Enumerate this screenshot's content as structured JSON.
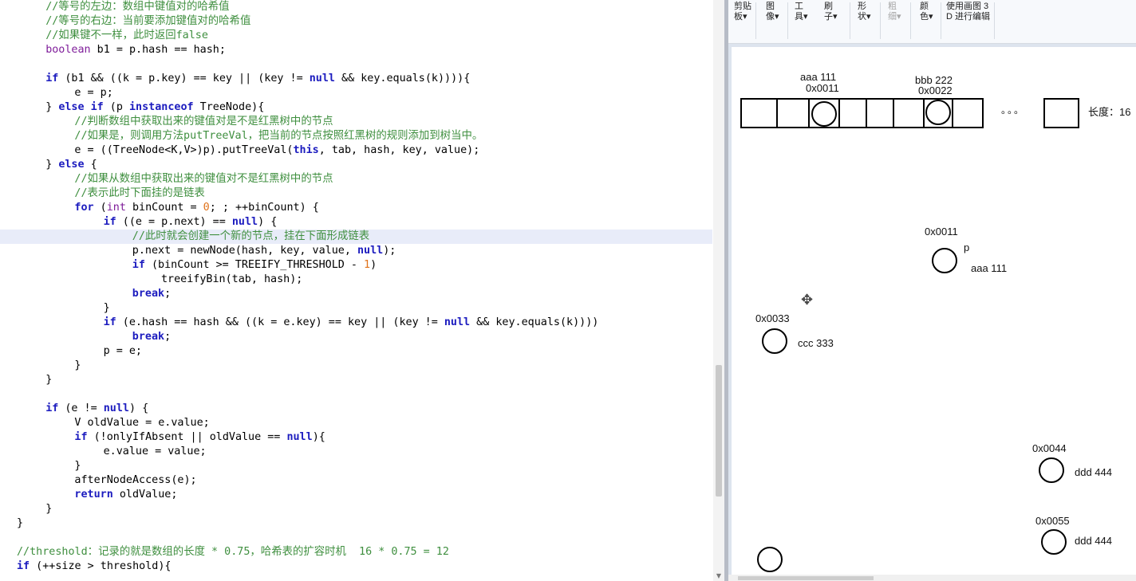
{
  "editor": {
    "lines": [
      {
        "indent": 4,
        "tokens": [
          {
            "t": "cm",
            "v": "//等号的左边：数组中键值对的哈希值"
          }
        ]
      },
      {
        "indent": 4,
        "tokens": [
          {
            "t": "cm",
            "v": "//等号的右边：当前要添加键值对的哈希值"
          }
        ]
      },
      {
        "indent": 4,
        "tokens": [
          {
            "t": "cm",
            "v": "//如果键不一样，此时返回false"
          }
        ]
      },
      {
        "indent": 4,
        "tokens": [
          {
            "t": "ty",
            "v": "boolean"
          },
          {
            "t": "tx",
            "v": " b1 = p.hash == hash;"
          }
        ]
      },
      {
        "indent": 0,
        "tokens": []
      },
      {
        "indent": 4,
        "tokens": [
          {
            "t": "kw",
            "v": "if"
          },
          {
            "t": "tx",
            "v": " (b1 && ((k = p.key) == key || (key != "
          },
          {
            "t": "kw",
            "v": "null"
          },
          {
            "t": "tx",
            "v": " && key.equals(k)))){"
          }
        ]
      },
      {
        "indent": 8,
        "tokens": [
          {
            "t": "tx",
            "v": "e = p;"
          }
        ]
      },
      {
        "indent": 4,
        "tokens": [
          {
            "t": "tx",
            "v": "} "
          },
          {
            "t": "kw",
            "v": "else if"
          },
          {
            "t": "tx",
            "v": " (p "
          },
          {
            "t": "kw",
            "v": "instanceof"
          },
          {
            "t": "tx",
            "v": " TreeNode){"
          }
        ]
      },
      {
        "indent": 8,
        "tokens": [
          {
            "t": "cm",
            "v": "//判断数组中获取出来的键值对是不是红黑树中的节点"
          }
        ]
      },
      {
        "indent": 8,
        "tokens": [
          {
            "t": "cm",
            "v": "//如果是，则调用方法putTreeVal，把当前的节点按照红黑树的规则添加到树当中。"
          }
        ]
      },
      {
        "indent": 8,
        "tokens": [
          {
            "t": "tx",
            "v": "e = ((TreeNode<K,V>)p).putTreeVal("
          },
          {
            "t": "kw",
            "v": "this"
          },
          {
            "t": "tx",
            "v": ", tab, hash, key, value);"
          }
        ]
      },
      {
        "indent": 4,
        "tokens": [
          {
            "t": "tx",
            "v": "} "
          },
          {
            "t": "kw",
            "v": "else"
          },
          {
            "t": "tx",
            "v": " {"
          }
        ]
      },
      {
        "indent": 8,
        "tokens": [
          {
            "t": "cm",
            "v": "//如果从数组中获取出来的键值对不是红黑树中的节点"
          }
        ]
      },
      {
        "indent": 8,
        "tokens": [
          {
            "t": "cm",
            "v": "//表示此时下面挂的是链表"
          }
        ]
      },
      {
        "indent": 8,
        "tokens": [
          {
            "t": "kw",
            "v": "for"
          },
          {
            "t": "tx",
            "v": " ("
          },
          {
            "t": "ty",
            "v": "int"
          },
          {
            "t": "tx",
            "v": " binCount = "
          },
          {
            "t": "num",
            "v": "0"
          },
          {
            "t": "tx",
            "v": "; ; ++binCount) {"
          }
        ]
      },
      {
        "indent": 12,
        "tokens": [
          {
            "t": "kw",
            "v": "if"
          },
          {
            "t": "tx",
            "v": " ((e = p.next) == "
          },
          {
            "t": "kw",
            "v": "null"
          },
          {
            "t": "tx",
            "v": ") {"
          }
        ]
      },
      {
        "indent": 16,
        "hl": true,
        "tokens": [
          {
            "t": "cm",
            "v": "//此时就会创建一个新的节点，挂在下面形成链表"
          }
        ]
      },
      {
        "indent": 16,
        "tokens": [
          {
            "t": "tx",
            "v": "p.next = newNode(hash, key, value, "
          },
          {
            "t": "kw",
            "v": "null"
          },
          {
            "t": "tx",
            "v": ");"
          }
        ]
      },
      {
        "indent": 16,
        "tokens": [
          {
            "t": "kw",
            "v": "if"
          },
          {
            "t": "tx",
            "v": " (binCount >= TREEIFY_THRESHOLD - "
          },
          {
            "t": "num",
            "v": "1"
          },
          {
            "t": "tx",
            "v": ")"
          }
        ]
      },
      {
        "indent": 20,
        "tokens": [
          {
            "t": "tx",
            "v": "treeifyBin(tab, hash);"
          }
        ]
      },
      {
        "indent": 16,
        "tokens": [
          {
            "t": "kw",
            "v": "break"
          },
          {
            "t": "tx",
            "v": ";"
          }
        ]
      },
      {
        "indent": 12,
        "tokens": [
          {
            "t": "tx",
            "v": "}"
          }
        ]
      },
      {
        "indent": 12,
        "tokens": [
          {
            "t": "kw",
            "v": "if"
          },
          {
            "t": "tx",
            "v": " (e.hash == hash && ((k = e.key) == key || (key != "
          },
          {
            "t": "kw",
            "v": "null"
          },
          {
            "t": "tx",
            "v": " && key.equals(k))))"
          }
        ]
      },
      {
        "indent": 16,
        "tokens": [
          {
            "t": "kw",
            "v": "break"
          },
          {
            "t": "tx",
            "v": ";"
          }
        ]
      },
      {
        "indent": 12,
        "tokens": [
          {
            "t": "tx",
            "v": "p = e;"
          }
        ]
      },
      {
        "indent": 8,
        "tokens": [
          {
            "t": "tx",
            "v": "}"
          }
        ]
      },
      {
        "indent": 4,
        "tokens": [
          {
            "t": "tx",
            "v": "}"
          }
        ]
      },
      {
        "indent": 0,
        "tokens": []
      },
      {
        "indent": 4,
        "tokens": [
          {
            "t": "kw",
            "v": "if"
          },
          {
            "t": "tx",
            "v": " (e != "
          },
          {
            "t": "kw",
            "v": "null"
          },
          {
            "t": "tx",
            "v": ") {"
          }
        ]
      },
      {
        "indent": 8,
        "tokens": [
          {
            "t": "tx",
            "v": "V oldValue = e.value;"
          }
        ]
      },
      {
        "indent": 8,
        "tokens": [
          {
            "t": "kw",
            "v": "if"
          },
          {
            "t": "tx",
            "v": " (!onlyIfAbsent || oldValue == "
          },
          {
            "t": "kw",
            "v": "null"
          },
          {
            "t": "tx",
            "v": "){"
          }
        ]
      },
      {
        "indent": 12,
        "tokens": [
          {
            "t": "tx",
            "v": "e.value = value;"
          }
        ]
      },
      {
        "indent": 8,
        "tokens": [
          {
            "t": "tx",
            "v": "}"
          }
        ]
      },
      {
        "indent": 8,
        "tokens": [
          {
            "t": "tx",
            "v": "afterNodeAccess(e);"
          }
        ]
      },
      {
        "indent": 8,
        "tokens": [
          {
            "t": "kw",
            "v": "return"
          },
          {
            "t": "tx",
            "v": " oldValue;"
          }
        ]
      },
      {
        "indent": 4,
        "tokens": [
          {
            "t": "tx",
            "v": "}"
          }
        ]
      },
      {
        "indent": 0,
        "tokens": [
          {
            "t": "tx",
            "v": "}"
          }
        ]
      },
      {
        "indent": 0,
        "tokens": []
      },
      {
        "indent": 0,
        "tokens": [
          {
            "t": "cm",
            "v": "//threshold：记录的就是数组的长度 * 0.75，哈希表的扩容时机  16 * 0.75 = 12"
          }
        ]
      },
      {
        "indent": 0,
        "tokens": [
          {
            "t": "kw",
            "v": "if"
          },
          {
            "t": "tx",
            "v": " (++size > threshold){"
          }
        ]
      }
    ]
  },
  "ribbon": {
    "clipboard": {
      "line1": "剪贴",
      "line2": "板▾"
    },
    "image": {
      "line1": "图",
      "line2": "像▾"
    },
    "tools": {
      "line1": "工",
      "line2": "具▾"
    },
    "brushes": {
      "line1": "刷",
      "line2": "子▾"
    },
    "shapes": {
      "line1": "形",
      "line2": "状▾"
    },
    "size": {
      "line1": "粗",
      "line2": "细▾"
    },
    "colors": {
      "line1": "颜",
      "line2": "色▾"
    },
    "paint3d": {
      "line1": "使用画图 3",
      "line2": "D 进行编辑"
    }
  },
  "drawing": {
    "array_labels": {
      "aaa": "aaa  111",
      "addr_0011_top": "0x0011",
      "bbb": "bbb 222",
      "addr_0022_top": "0x0022",
      "ellipsis": "。。。",
      "length": "长度：16"
    },
    "nodes": {
      "n1_addr": "0x0011",
      "n1_var": "p",
      "n1_value": "aaa  111",
      "n2_addr": "0x0033",
      "n2_value": "ccc 333",
      "n3_addr": "0x0044",
      "n3_value": "ddd 444",
      "n4_addr": "0x0055",
      "n4_value": "ddd 444"
    }
  },
  "colors": {
    "keyword": "#1c1cbf",
    "type": "#7f1d9a",
    "comment": "#3f8f3f",
    "number": "#e0731b",
    "highlight_line": "#e8ecf9"
  },
  "icons": {
    "cursor": "move-cursor-icon",
    "scroll_arrow": "chevron-down-icon"
  }
}
